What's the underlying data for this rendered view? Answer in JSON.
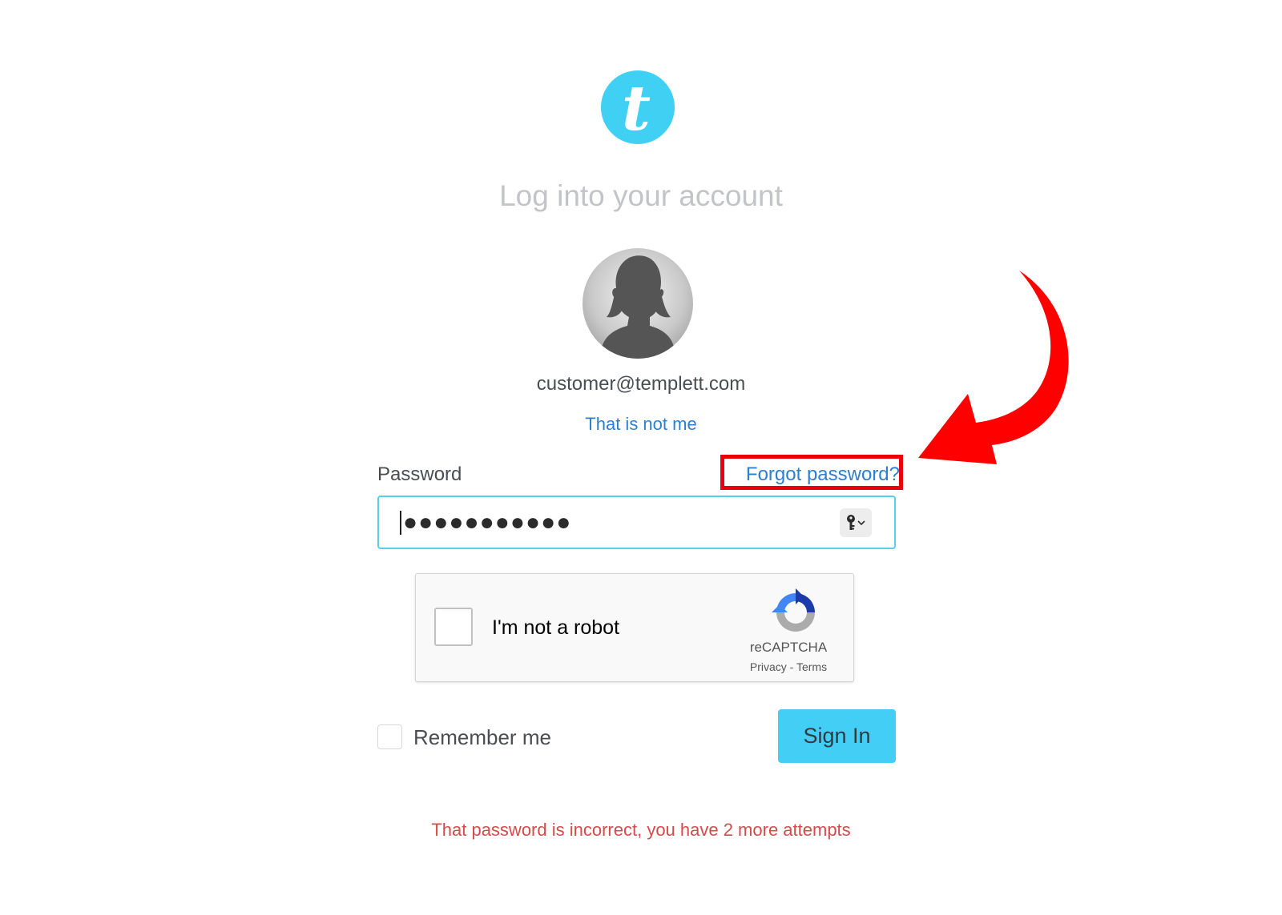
{
  "logo": {
    "letter": "t",
    "color": "#3fd0f4"
  },
  "header": {
    "title": "Log into your account"
  },
  "account": {
    "avatar_icon": "user-silhouette-icon",
    "email": "customer@templett.com",
    "not_me_label": "That is not me"
  },
  "password": {
    "label": "Password",
    "forgot_label": "Forgot password?",
    "masked_value": "●●●●●●●●●●●",
    "key_icon": "password-manager-key-icon"
  },
  "recaptcha": {
    "label": "I'm not a robot",
    "brand": "reCAPTCHA",
    "privacy": "Privacy",
    "separator": " - ",
    "terms": "Terms",
    "checked": false
  },
  "remember": {
    "label": "Remember me",
    "checked": false
  },
  "sign_in": {
    "label": "Sign In",
    "color": "#43cff5"
  },
  "error": {
    "message": "That password is incorrect, you have 2 more attempts",
    "color": "#d84a4a"
  },
  "annotation": {
    "highlight_color": "#e8000b",
    "arrow_icon": "curved-arrow-icon"
  },
  "colors": {
    "link": "#2d7fd1",
    "input_border": "#54d1ea"
  }
}
